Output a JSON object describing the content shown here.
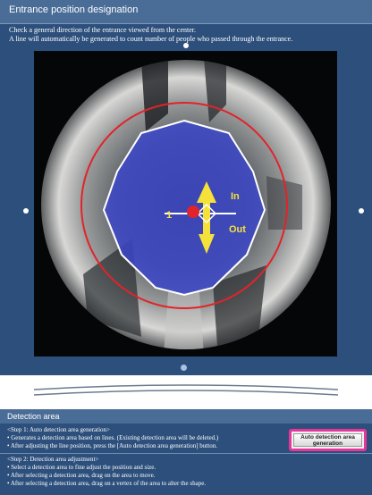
{
  "entrance_panel": {
    "title": "Entrance position designation",
    "instructions": [
      "Check a general direction of the entrance viewed from the center.",
      "A line will automatically be generated to count number of people who passed through the entrance."
    ],
    "line_number": "1",
    "label_in": "In",
    "label_out": "Out"
  },
  "detection_panel": {
    "title": "Detection area",
    "step1": {
      "heading": "<Step 1: Auto detection area generation>",
      "bullets": [
        "• Generates a detection area based on lines. (Existing detection area will be deleted.)",
        "• After adjusting the line position, press the [Auto detection area generation] button."
      ]
    },
    "step2": {
      "heading": "<Step 2: Detection area adjustment>",
      "bullets": [
        "• Select a detection area to fine adjust the position and size.",
        "• After selecting a detection area, drag on the area to move.",
        "• After selecting a detection area, drag on a vertex of the area to alter the shape."
      ]
    },
    "generate_button_label": "Auto detection area generation"
  },
  "colors": {
    "panel_bg": "#2d4f7c",
    "header_bg": "#4a6d97",
    "detection_area_fill": "#3c46c8",
    "guide_circle": "#e0242a",
    "arrow": "#f4e23a",
    "highlight_border": "#e8359a"
  }
}
